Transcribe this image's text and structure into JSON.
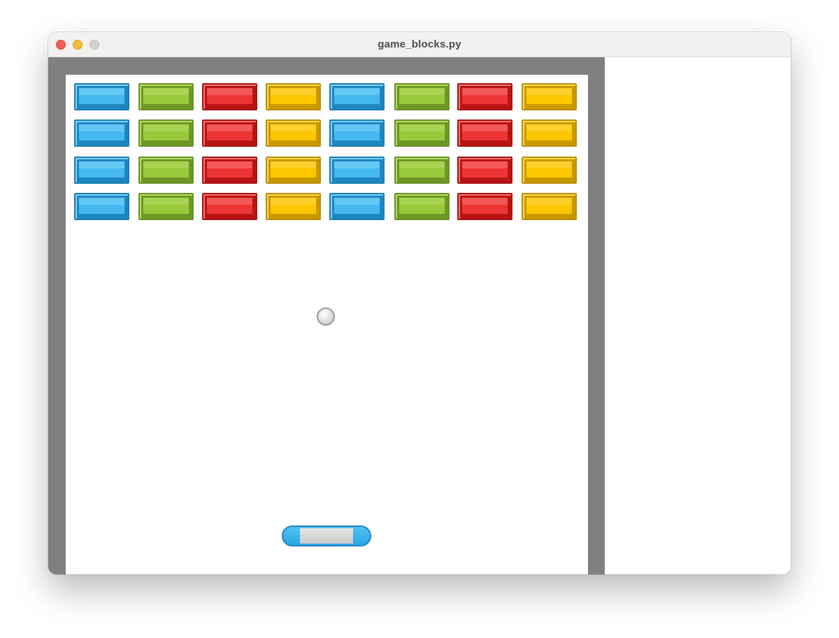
{
  "window": {
    "title": "game_blocks.py"
  },
  "colors": {
    "frame": "#7f7f7f",
    "field": "#ffffff",
    "blue": {
      "fill": "#45b9ef",
      "light": "#7fd3f7",
      "dark": "#1d87c2",
      "border": "#1b7cb4"
    },
    "green": {
      "fill": "#98c93a",
      "light": "#b7dc66",
      "dark": "#6f9723",
      "border": "#6a9128"
    },
    "red": {
      "fill": "#ee3535",
      "light": "#f67474",
      "dark": "#b81414",
      "border": "#a81313"
    },
    "yellow": {
      "fill": "#fcc601",
      "light": "#ffd951",
      "dark": "#c99a00",
      "border": "#b88f0d"
    }
  },
  "game": {
    "brick_rows": [
      [
        "blue",
        "green",
        "red",
        "yellow",
        "blue",
        "green",
        "red",
        "yellow"
      ],
      [
        "blue",
        "green",
        "red",
        "yellow",
        "blue",
        "green",
        "red",
        "yellow"
      ],
      [
        "blue",
        "green",
        "red",
        "yellow",
        "blue",
        "green",
        "red",
        "yellow"
      ],
      [
        "blue",
        "green",
        "red",
        "yellow",
        "blue",
        "green",
        "red",
        "yellow"
      ]
    ],
    "ball": {
      "icon": "ball-icon"
    },
    "paddle": {
      "icon": "paddle-icon"
    }
  }
}
